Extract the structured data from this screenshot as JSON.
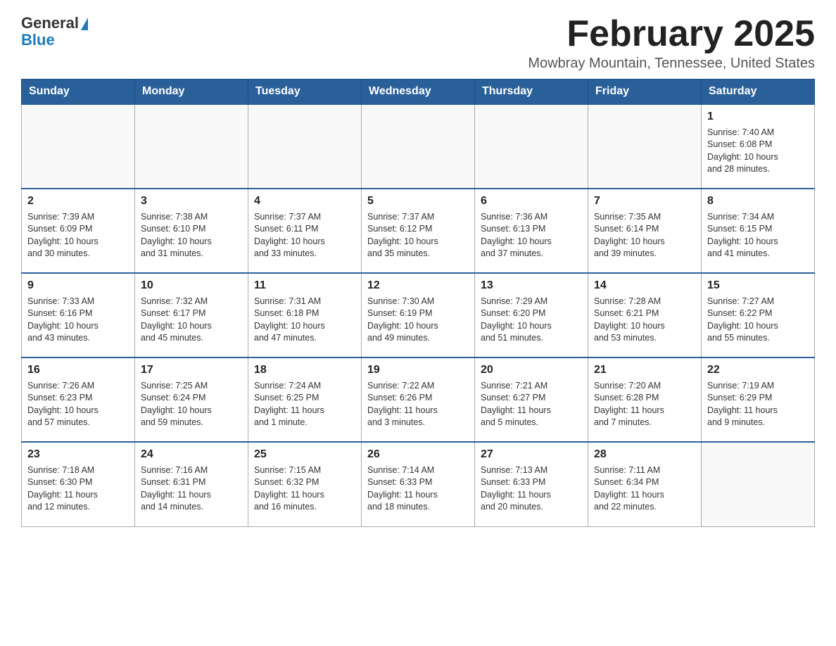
{
  "header": {
    "logo_general": "General",
    "logo_blue": "Blue",
    "month_year": "February 2025",
    "location": "Mowbray Mountain, Tennessee, United States"
  },
  "weekdays": [
    "Sunday",
    "Monday",
    "Tuesday",
    "Wednesday",
    "Thursday",
    "Friday",
    "Saturday"
  ],
  "weeks": [
    [
      {
        "day": "",
        "info": ""
      },
      {
        "day": "",
        "info": ""
      },
      {
        "day": "",
        "info": ""
      },
      {
        "day": "",
        "info": ""
      },
      {
        "day": "",
        "info": ""
      },
      {
        "day": "",
        "info": ""
      },
      {
        "day": "1",
        "info": "Sunrise: 7:40 AM\nSunset: 6:08 PM\nDaylight: 10 hours\nand 28 minutes."
      }
    ],
    [
      {
        "day": "2",
        "info": "Sunrise: 7:39 AM\nSunset: 6:09 PM\nDaylight: 10 hours\nand 30 minutes."
      },
      {
        "day": "3",
        "info": "Sunrise: 7:38 AM\nSunset: 6:10 PM\nDaylight: 10 hours\nand 31 minutes."
      },
      {
        "day": "4",
        "info": "Sunrise: 7:37 AM\nSunset: 6:11 PM\nDaylight: 10 hours\nand 33 minutes."
      },
      {
        "day": "5",
        "info": "Sunrise: 7:37 AM\nSunset: 6:12 PM\nDaylight: 10 hours\nand 35 minutes."
      },
      {
        "day": "6",
        "info": "Sunrise: 7:36 AM\nSunset: 6:13 PM\nDaylight: 10 hours\nand 37 minutes."
      },
      {
        "day": "7",
        "info": "Sunrise: 7:35 AM\nSunset: 6:14 PM\nDaylight: 10 hours\nand 39 minutes."
      },
      {
        "day": "8",
        "info": "Sunrise: 7:34 AM\nSunset: 6:15 PM\nDaylight: 10 hours\nand 41 minutes."
      }
    ],
    [
      {
        "day": "9",
        "info": "Sunrise: 7:33 AM\nSunset: 6:16 PM\nDaylight: 10 hours\nand 43 minutes."
      },
      {
        "day": "10",
        "info": "Sunrise: 7:32 AM\nSunset: 6:17 PM\nDaylight: 10 hours\nand 45 minutes."
      },
      {
        "day": "11",
        "info": "Sunrise: 7:31 AM\nSunset: 6:18 PM\nDaylight: 10 hours\nand 47 minutes."
      },
      {
        "day": "12",
        "info": "Sunrise: 7:30 AM\nSunset: 6:19 PM\nDaylight: 10 hours\nand 49 minutes."
      },
      {
        "day": "13",
        "info": "Sunrise: 7:29 AM\nSunset: 6:20 PM\nDaylight: 10 hours\nand 51 minutes."
      },
      {
        "day": "14",
        "info": "Sunrise: 7:28 AM\nSunset: 6:21 PM\nDaylight: 10 hours\nand 53 minutes."
      },
      {
        "day": "15",
        "info": "Sunrise: 7:27 AM\nSunset: 6:22 PM\nDaylight: 10 hours\nand 55 minutes."
      }
    ],
    [
      {
        "day": "16",
        "info": "Sunrise: 7:26 AM\nSunset: 6:23 PM\nDaylight: 10 hours\nand 57 minutes."
      },
      {
        "day": "17",
        "info": "Sunrise: 7:25 AM\nSunset: 6:24 PM\nDaylight: 10 hours\nand 59 minutes."
      },
      {
        "day": "18",
        "info": "Sunrise: 7:24 AM\nSunset: 6:25 PM\nDaylight: 11 hours\nand 1 minute."
      },
      {
        "day": "19",
        "info": "Sunrise: 7:22 AM\nSunset: 6:26 PM\nDaylight: 11 hours\nand 3 minutes."
      },
      {
        "day": "20",
        "info": "Sunrise: 7:21 AM\nSunset: 6:27 PM\nDaylight: 11 hours\nand 5 minutes."
      },
      {
        "day": "21",
        "info": "Sunrise: 7:20 AM\nSunset: 6:28 PM\nDaylight: 11 hours\nand 7 minutes."
      },
      {
        "day": "22",
        "info": "Sunrise: 7:19 AM\nSunset: 6:29 PM\nDaylight: 11 hours\nand 9 minutes."
      }
    ],
    [
      {
        "day": "23",
        "info": "Sunrise: 7:18 AM\nSunset: 6:30 PM\nDaylight: 11 hours\nand 12 minutes."
      },
      {
        "day": "24",
        "info": "Sunrise: 7:16 AM\nSunset: 6:31 PM\nDaylight: 11 hours\nand 14 minutes."
      },
      {
        "day": "25",
        "info": "Sunrise: 7:15 AM\nSunset: 6:32 PM\nDaylight: 11 hours\nand 16 minutes."
      },
      {
        "day": "26",
        "info": "Sunrise: 7:14 AM\nSunset: 6:33 PM\nDaylight: 11 hours\nand 18 minutes."
      },
      {
        "day": "27",
        "info": "Sunrise: 7:13 AM\nSunset: 6:33 PM\nDaylight: 11 hours\nand 20 minutes."
      },
      {
        "day": "28",
        "info": "Sunrise: 7:11 AM\nSunset: 6:34 PM\nDaylight: 11 hours\nand 22 minutes."
      },
      {
        "day": "",
        "info": ""
      }
    ]
  ]
}
